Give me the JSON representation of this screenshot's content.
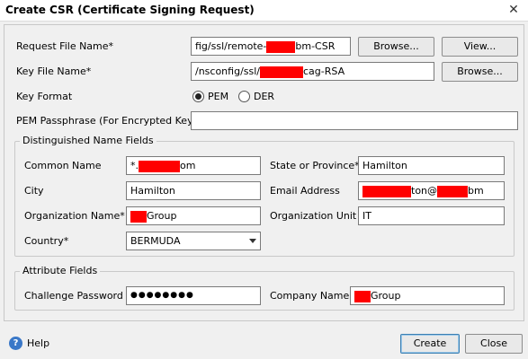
{
  "window": {
    "title": "Create CSR (Certificate Signing Request)",
    "close_glyph": "✕"
  },
  "form": {
    "request_file": {
      "label": "Request File Name*",
      "value_start": "fig/ssl/remote-",
      "value_end": "bm-CSR",
      "browse_label": "Browse...",
      "view_label": "View..."
    },
    "key_file": {
      "label": "Key File Name*",
      "value_start": "/nsconfig/ssl/",
      "value_end": "cag-RSA",
      "browse_label": "Browse..."
    },
    "key_format": {
      "label": "Key Format",
      "options": [
        {
          "label": "PEM",
          "selected": true
        },
        {
          "label": "DER",
          "selected": false
        }
      ]
    },
    "pem_passphrase": {
      "label": "PEM Passphrase (For Encrypted Key)",
      "value": ""
    }
  },
  "dn_group": {
    "legend": "Distinguished Name Fields",
    "common_name": {
      "label": "Common Name",
      "value_start": "*.",
      "value_end": "om"
    },
    "state": {
      "label": "State or Province*",
      "value": "Hamilton"
    },
    "city": {
      "label": "City",
      "value": "Hamilton"
    },
    "email": {
      "label": "Email Address",
      "value_mid": "ton@",
      "value_end": "bm"
    },
    "org_name": {
      "label": "Organization Name*",
      "value_end": "Group"
    },
    "org_unit": {
      "label": "Organization Unit",
      "value": "IT"
    },
    "country": {
      "label": "Country*",
      "value": "BERMUDA"
    }
  },
  "attr_group": {
    "legend": "Attribute Fields",
    "challenge_password": {
      "label": "Challenge Password",
      "value": "●●●●●●●●"
    },
    "company_name": {
      "label": "Company Name",
      "value_end": "Group"
    }
  },
  "footer": {
    "help_label": "Help",
    "help_icon_glyph": "?",
    "create_label": "Create",
    "close_label": "Close"
  },
  "colors": {
    "redaction": "#ff0000",
    "dialog_bg": "#f0f0f0",
    "default_button_border": "#3c7fb1"
  }
}
